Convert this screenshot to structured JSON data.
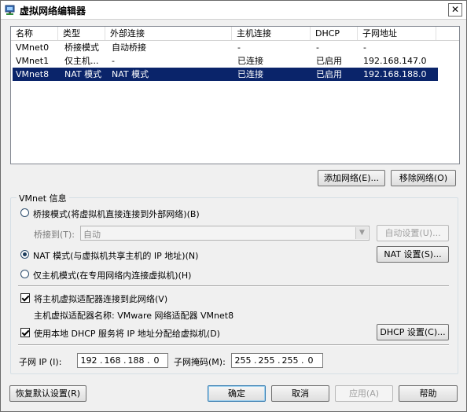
{
  "window": {
    "title": "虚拟网络编辑器",
    "close_glyph": "✕"
  },
  "table": {
    "columns": [
      "名称",
      "类型",
      "外部连接",
      "主机连接",
      "DHCP",
      "子网地址"
    ],
    "rows": [
      {
        "name": "VMnet0",
        "type": "桥接模式",
        "external": "自动桥接",
        "host": "-",
        "dhcp": "-",
        "subnet": "-",
        "selected": false
      },
      {
        "name": "VMnet1",
        "type": "仅主机...",
        "external": "-",
        "host": "已连接",
        "dhcp": "已启用",
        "subnet": "192.168.147.0",
        "selected": false
      },
      {
        "name": "VMnet8",
        "type": "NAT 模式",
        "external": "NAT 模式",
        "host": "已连接",
        "dhcp": "已启用",
        "subnet": "192.168.188.0",
        "selected": true
      }
    ]
  },
  "buttons": {
    "add_network": "添加网络(E)...",
    "remove_network": "移除网络(O)",
    "auto_settings": "自动设置(U)...",
    "nat_settings": "NAT 设置(S)...",
    "dhcp_settings": "DHCP 设置(C)...",
    "restore_defaults": "恢复默认设置(R)",
    "ok": "确定",
    "cancel": "取消",
    "apply": "应用(A)",
    "help": "帮助"
  },
  "vmnet_info": {
    "group_title": "VMnet 信息",
    "bridged_label": "桥接模式(将虚拟机直接连接到外部网络)(B)",
    "bridged_to_label": "桥接到(T):",
    "bridged_to_value": "自动",
    "nat_label": "NAT 模式(与虚拟机共享主机的 IP 地址)(N)",
    "hostonly_label": "仅主机模式(在专用网络内连接虚拟机)(H)",
    "selected_mode": "nat",
    "connect_adapter_label": "将主机虚拟适配器连接到此网络(V)",
    "connect_adapter_checked": true,
    "adapter_name_text": "主机虚拟适配器名称: VMware 网络适配器 VMnet8",
    "use_dhcp_label": "使用本地 DHCP 服务将 IP 地址分配给虚拟机(D)",
    "use_dhcp_checked": true,
    "subnet_ip_label": "子网 IP (I):",
    "subnet_ip": [
      "192",
      "168",
      "188",
      "0"
    ],
    "subnet_mask_label": "子网掩码(M):",
    "subnet_mask": [
      "255",
      "255",
      "255",
      "0"
    ]
  },
  "colors": {
    "selection": "#0a246a",
    "window_bg": "#f0f0f0"
  },
  "icons": {
    "app": "network-editor-icon",
    "close": "close-icon",
    "dropdown": "chevron-down-icon"
  }
}
